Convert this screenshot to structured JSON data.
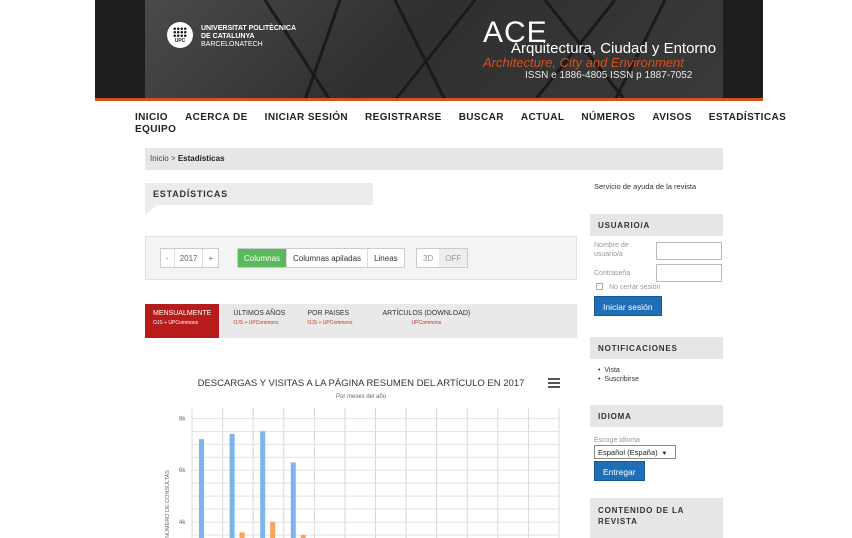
{
  "header": {
    "university_lines": [
      "UNIVERSITAT POLITÈCNICA",
      "DE CATALUNYA",
      "BARCELONATECH"
    ],
    "logo_text": "UPC",
    "journal_abbr": "ACE",
    "journal_name_es": "Arquitectura, Ciudad y Entorno",
    "journal_name_en": "Architecture, City and Environment",
    "issn": "ISSN e 1886-4805    ISSN p 1887-7052",
    "accent_color": "#d2521f"
  },
  "nav": {
    "items": [
      "INICIO",
      "ACERCA DE",
      "INICIAR SESIÓN",
      "REGISTRARSE",
      "BUSCAR",
      "ACTUAL",
      "NÚMEROS",
      "AVISOS",
      "ESTADÍSTICAS"
    ],
    "items_row2": [
      "EQUIPO"
    ]
  },
  "breadcrumb": {
    "home": "Inicio",
    "sep": ">",
    "current": "Estadísticas"
  },
  "page_title": "ESTADÍSTICAS",
  "controls": {
    "year_prev": "-",
    "year": "2017",
    "year_next": "+",
    "chart_types": [
      "Columnas",
      "Columnas apiladas",
      "Lineas"
    ],
    "active_type": "Columnas",
    "toggle_3d_label": "3D",
    "toggle_3d_value": "OFF",
    "active_color": "#5cb85c"
  },
  "tabs": [
    {
      "label": "MENSUALMENTE",
      "sub": "OJS + UPCommons",
      "active": true
    },
    {
      "label": "ÚLTIMOS AÑOS",
      "sub": "OJS + UPCommons",
      "active": false
    },
    {
      "label": "POR PAISES",
      "sub": "OJS + UPCommons",
      "active": false
    },
    {
      "label": "ARTÍCULOS (DOWNLOAD)",
      "sub": "UPCommons",
      "active": false
    }
  ],
  "chart_data": {
    "type": "bar",
    "title": "DESCARGAS Y VISITAS A LA PÁGINA RESUMEN DEL ARTÍCULO EN 2017",
    "subtitle": "Por meses del año",
    "ylabel": "NÚMERO DE CONSULTAS",
    "y_ticks": [
      "8k",
      "6k",
      "4k"
    ],
    "ylim": [
      3000,
      8400
    ],
    "categories_count": 12,
    "series": [
      {
        "color": "#7cb5ec",
        "values": [
          7200,
          7400,
          7500,
          6300,
          null,
          null,
          null,
          null,
          null,
          null,
          null,
          null
        ]
      },
      {
        "color": "#f7a35c",
        "values": [
          3100,
          3600,
          4000,
          3500,
          null,
          null,
          null,
          null,
          null,
          null,
          null,
          null
        ]
      }
    ],
    "grid": true
  },
  "sidebar": {
    "help_link": "Servicio de ayuda de la revista",
    "user_block": "USUARIO/A",
    "username_label_1": "Nombre de",
    "username_label_2": "usuario/a",
    "password_label": "Contraseña",
    "remember_label": "No cerrar sesión",
    "login_button": "Iniciar sesión",
    "notif_block": "NOTIFICACIONES",
    "notif_items": [
      "Vista",
      "Suscribirse"
    ],
    "lang_block": "IDIOMA",
    "lang_label": "Escoge idioma",
    "lang_value": "Español (España)",
    "lang_button": "Entregar",
    "content_block_1": "CONTENIDO DE LA",
    "content_block_2": "REVISTA",
    "button_color": "#1e6fb8"
  }
}
